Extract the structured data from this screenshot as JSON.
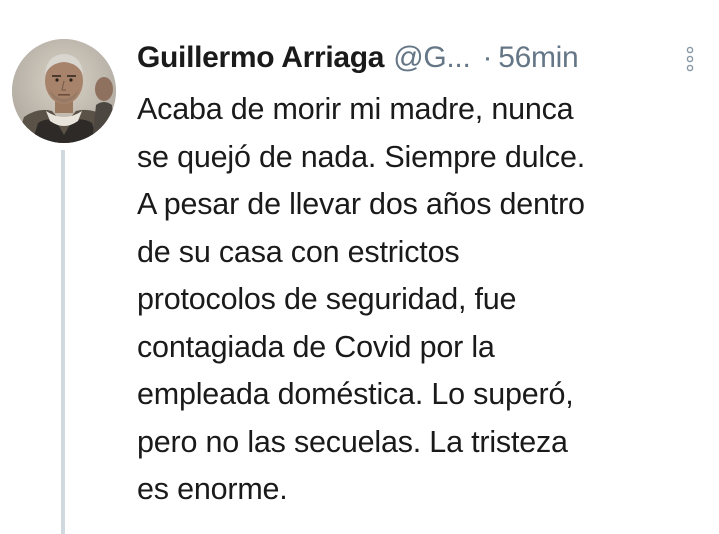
{
  "tweet": {
    "author": {
      "display_name": "Guillermo Arriaga",
      "handle": "@G..."
    },
    "separator": "·",
    "timestamp": "56min",
    "more_icon": "more-vertical-icon",
    "body_lines": [
      "Acaba de morir mi madre, nunca",
      "se quejó de nada.  Siempre dulce.",
      "A pesar de llevar dos años dentro",
      "de su casa con estrictos",
      "protocolos de seguridad, fue",
      "contagiada de Covid por la",
      "empleada doméstica. Lo superó,",
      "pero no las secuelas. La tristeza",
      "es enorme."
    ]
  },
  "colors": {
    "text": "#1a1a1a",
    "secondary_text": "#657786",
    "thread_line": "#cfd9de",
    "background": "#ffffff"
  }
}
